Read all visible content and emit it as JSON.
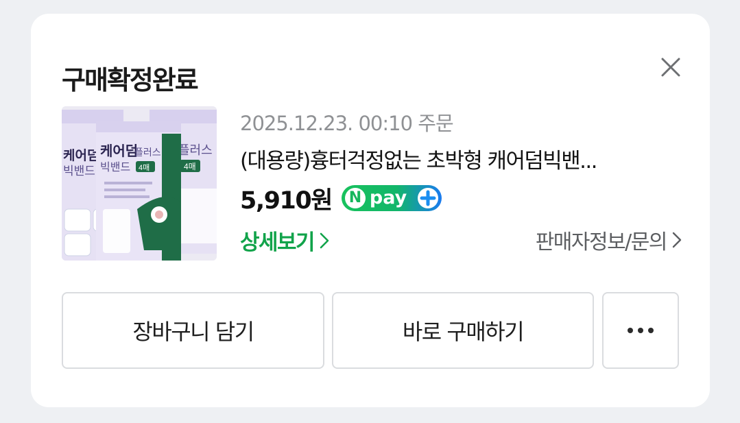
{
  "card": {
    "title": "구매확정완료",
    "close_icon": "close-icon"
  },
  "order": {
    "date": "2025.12.23. 00:10 주문",
    "product_name": "(대용량)흉터걱정없는 초박형 캐어덤빅밴...",
    "price": "5,910원",
    "payment_badge": {
      "icon": "npay-plus-icon",
      "label": "pay"
    },
    "image": {
      "front_box": {
        "brand": "케어덤",
        "line1": "플러스",
        "line2": "빅밴드",
        "count": "4매"
      },
      "back_box": {
        "line1": "케어덤",
        "line2": "빅밴드"
      },
      "right_box": {
        "line1": "플러스",
        "count": "4매"
      },
      "colors": {
        "box": "#e7e2f4",
        "green": "#1f6d47",
        "purple": "#9f93c9"
      }
    }
  },
  "links": {
    "detail": "상세보기",
    "seller": "판매자정보/문의"
  },
  "buttons": {
    "cart": "장바구니 담기",
    "buy": "바로 구매하기",
    "more_icon": "more-dots-icon"
  },
  "colors": {
    "accent_green": "#11a34a",
    "background": "#eef0f3"
  }
}
